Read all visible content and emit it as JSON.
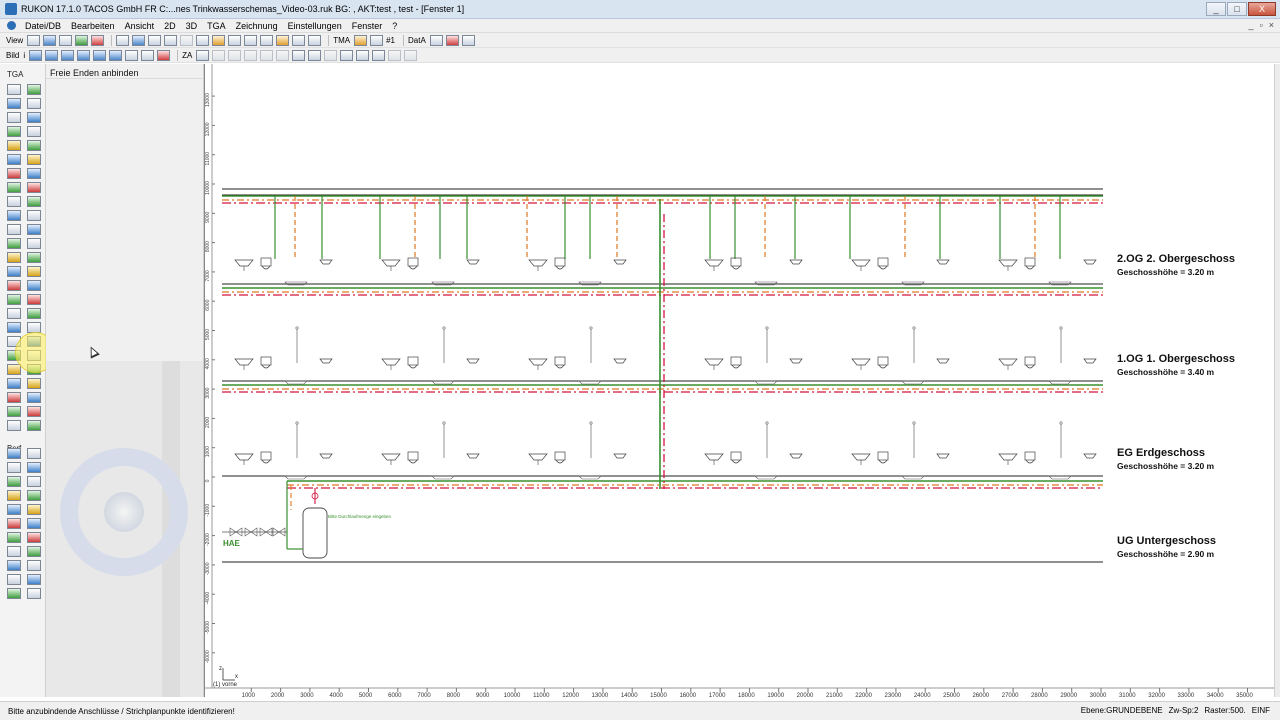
{
  "window": {
    "title": "RUKON 17.1.0 TACOS GmbH FR          C:...nes Trinkwasserschemas_Video-03.ruk  BG: ,   AKT:test , test - [Fenster 1]",
    "buttons": {
      "minimize": "_",
      "maximize": "□",
      "close": "X"
    }
  },
  "menu": {
    "items": [
      "Datei/DB",
      "Bearbeiten",
      "Ansicht",
      "2D",
      "3D",
      "TGA",
      "Zeichnung",
      "Einstellungen",
      "Fenster",
      "?"
    ],
    "mdi_buttons": [
      "_",
      "▫",
      "×"
    ]
  },
  "toolbar1": {
    "view_label": "View",
    "tma_label": "TMA",
    "hash_label": "#1",
    "data_label": "DatA"
  },
  "toolbar2": {
    "bild_label": "Bild",
    "info_label": "i",
    "za_label": "ZA"
  },
  "left_tools": {
    "tga_label": "TGA",
    "bsrf_label": "Bsrf"
  },
  "side_panel": {
    "title": "Freie Enden anbinden"
  },
  "drawing": {
    "floors": [
      {
        "code": "2.OG",
        "name": "2. Obergeschoss",
        "height_text": "Geschosshöhe = 3.20 m"
      },
      {
        "code": "1.OG",
        "name": "1. Obergeschoss",
        "height_text": "Geschosshöhe = 3.40 m"
      },
      {
        "code": "EG",
        "name": "Erdgeschoss",
        "height_text": "Geschosshöhe = 3.20 m"
      },
      {
        "code": "UG",
        "name": "Untergeschoss",
        "height_text": "Geschosshöhe = 2.90 m"
      }
    ],
    "hae_label": "HAE",
    "tank_note": "Bitte Durchlaufmenge eingeben",
    "view_label": "(1) vorne",
    "axis_labels": {
      "z": "z",
      "x": "x"
    },
    "ruler_bottom": [
      "1000",
      "2000",
      "3000",
      "4000",
      "5000",
      "6000",
      "7000",
      "8000",
      "9000",
      "10000",
      "11000",
      "12000",
      "13000",
      "14000",
      "15000",
      "16000",
      "17000",
      "18000",
      "19000",
      "20000",
      "21000",
      "22000",
      "23000",
      "24000",
      "25000",
      "26000",
      "27000",
      "28000",
      "29000",
      "30000",
      "31000",
      "32000",
      "33000",
      "34000",
      "35000"
    ],
    "ruler_left": [
      "13000",
      "12000",
      "11000",
      "10000",
      "9000",
      "8000",
      "7000",
      "6000",
      "5000",
      "4000",
      "3000",
      "2000",
      "1000",
      "0",
      "-1000",
      "-2000",
      "-3000",
      "-4000",
      "-5000",
      "-6000"
    ],
    "colors": {
      "green": "#3a8f2e",
      "orange": "#e07820",
      "red": "#d4143c",
      "magenta": "#c8207a",
      "line": "#222222"
    }
  },
  "status": {
    "message": "Bitte anzubindende Anschlüsse / Strichplanpunkte identifizieren!",
    "ebene": "Ebene:GRUNDEBENE",
    "zwsp": "Zw-Sp:2",
    "raster": "Raster:500.",
    "mode": "EINF"
  }
}
